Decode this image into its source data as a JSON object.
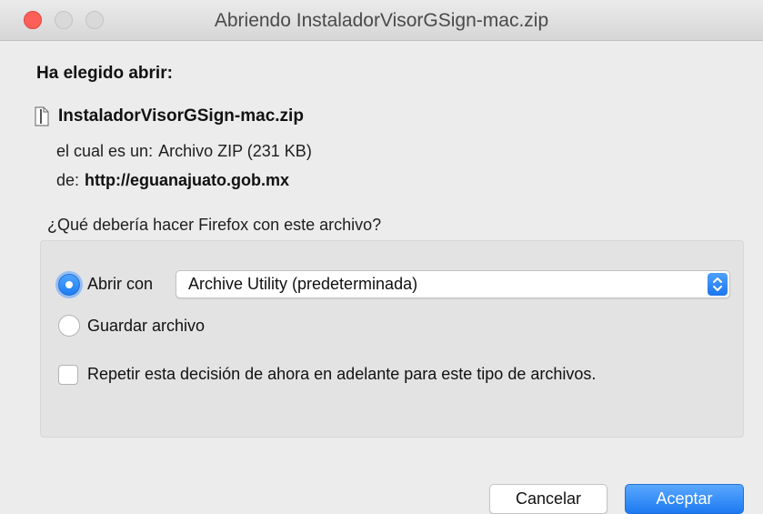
{
  "window": {
    "title": "Abriendo InstaladorVisorGSign-mac.zip"
  },
  "dialog": {
    "heading": "Ha elegido abrir:",
    "file_name": "InstaladorVisorGSign-mac.zip",
    "type_label": "el cual es un:",
    "type_value": "Archivo ZIP (231 KB)",
    "from_label": "de:",
    "from_value": "http://eguanajuato.gob.mx",
    "question": "¿Qué debería hacer Firefox con este archivo?"
  },
  "options": {
    "open_with": {
      "label": "Abrir con",
      "selected": true,
      "app": "Archive Utility (predeterminada)"
    },
    "save_file": {
      "label": "Guardar archivo",
      "selected": false
    },
    "remember": {
      "label": "Repetir esta decisión de ahora en adelante para este tipo de archivos.",
      "checked": false
    }
  },
  "buttons": {
    "cancel": "Cancelar",
    "accept": "Aceptar"
  },
  "colors": {
    "accent": "#1f7df3",
    "close_button": "#fc5f57"
  }
}
